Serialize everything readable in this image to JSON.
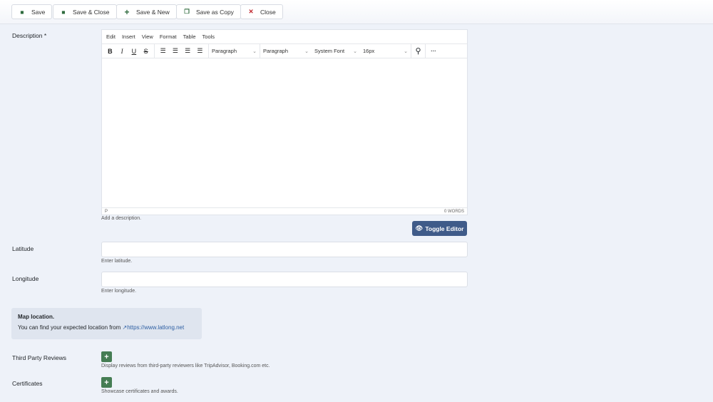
{
  "toolbar": {
    "save": "Save",
    "save_close": "Save & Close",
    "save_new": "Save & New",
    "save_copy": "Save as Copy",
    "close": "Close"
  },
  "description": {
    "label": "Description *",
    "menu": [
      "Edit",
      "Insert",
      "View",
      "Format",
      "Table",
      "Tools"
    ],
    "block1": "Paragraph",
    "block2": "Paragraph",
    "font": "System Font",
    "size": "16px",
    "path": "P",
    "words": "0 WORDS",
    "help": "Add a description.",
    "toggle": "Toggle Editor"
  },
  "latitude": {
    "label": "Latitude",
    "value": "",
    "help": "Enter latitude."
  },
  "longitude": {
    "label": "Longitude",
    "value": "",
    "help": "Enter longitude."
  },
  "alert": {
    "title": "Map location.",
    "text": "You can find your expected location from",
    "link": "https://www.latlong.net"
  },
  "reviews": {
    "label": "Third Party Reviews",
    "help": "Display reviews from third-party reviewers like TripAdvisor, Booking.com etc."
  },
  "certificates": {
    "label": "Certificates",
    "help": "Showcase certificates and awards."
  },
  "colors": {
    "primary": "#3f5b89",
    "success": "#457d54",
    "danger": "#c0262d"
  }
}
